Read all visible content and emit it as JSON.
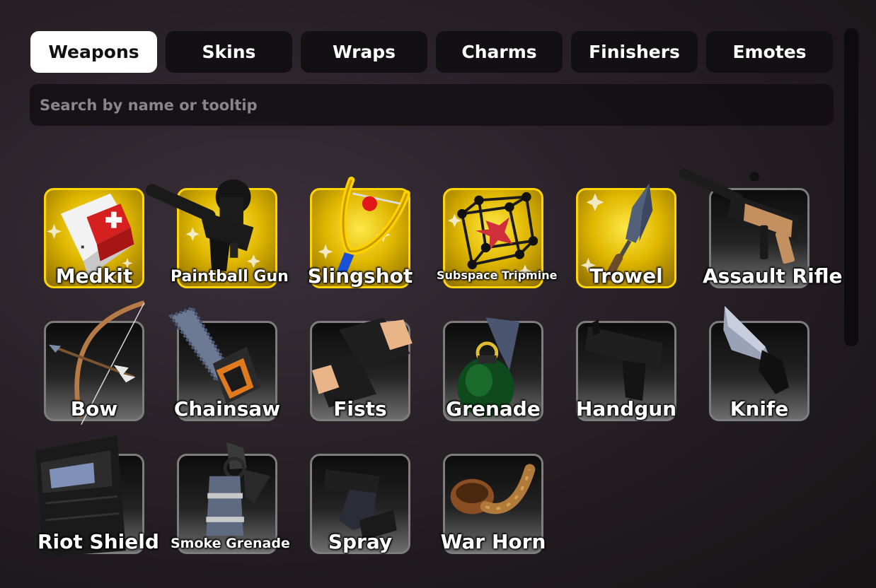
{
  "tabs": [
    {
      "label": "Weapons",
      "active": true
    },
    {
      "label": "Skins",
      "active": false
    },
    {
      "label": "Wraps",
      "active": false
    },
    {
      "label": "Charms",
      "active": false
    },
    {
      "label": "Finishers",
      "active": false
    },
    {
      "label": "Emotes",
      "active": false
    }
  ],
  "search": {
    "placeholder": "Search by name or tooltip",
    "value": ""
  },
  "weapons": [
    {
      "name": "Medkit",
      "rarity": "gold",
      "icon": "medkit-icon"
    },
    {
      "name": "Paintball Gun",
      "rarity": "gold",
      "icon": "paintball-gun-icon"
    },
    {
      "name": "Slingshot",
      "rarity": "gold",
      "icon": "slingshot-icon"
    },
    {
      "name": "Subspace Tripmine",
      "rarity": "gold",
      "icon": "tripmine-icon"
    },
    {
      "name": "Trowel",
      "rarity": "gold",
      "icon": "trowel-icon"
    },
    {
      "name": "Assault Rifle",
      "rarity": "standard",
      "icon": "assault-rifle-icon"
    },
    {
      "name": "Bow",
      "rarity": "standard",
      "icon": "bow-icon"
    },
    {
      "name": "Chainsaw",
      "rarity": "standard",
      "icon": "chainsaw-icon"
    },
    {
      "name": "Fists",
      "rarity": "standard",
      "icon": "fists-icon"
    },
    {
      "name": "Grenade",
      "rarity": "standard",
      "icon": "grenade-icon"
    },
    {
      "name": "Handgun",
      "rarity": "standard",
      "icon": "handgun-icon"
    },
    {
      "name": "Knife",
      "rarity": "standard",
      "icon": "knife-icon"
    },
    {
      "name": "Riot Shield",
      "rarity": "standard",
      "icon": "riot-shield-icon"
    },
    {
      "name": "Smoke Grenade",
      "rarity": "standard",
      "icon": "smoke-grenade-icon"
    },
    {
      "name": "Spray",
      "rarity": "standard",
      "icon": "spray-icon"
    },
    {
      "name": "War Horn",
      "rarity": "standard",
      "icon": "war-horn-icon"
    }
  ]
}
